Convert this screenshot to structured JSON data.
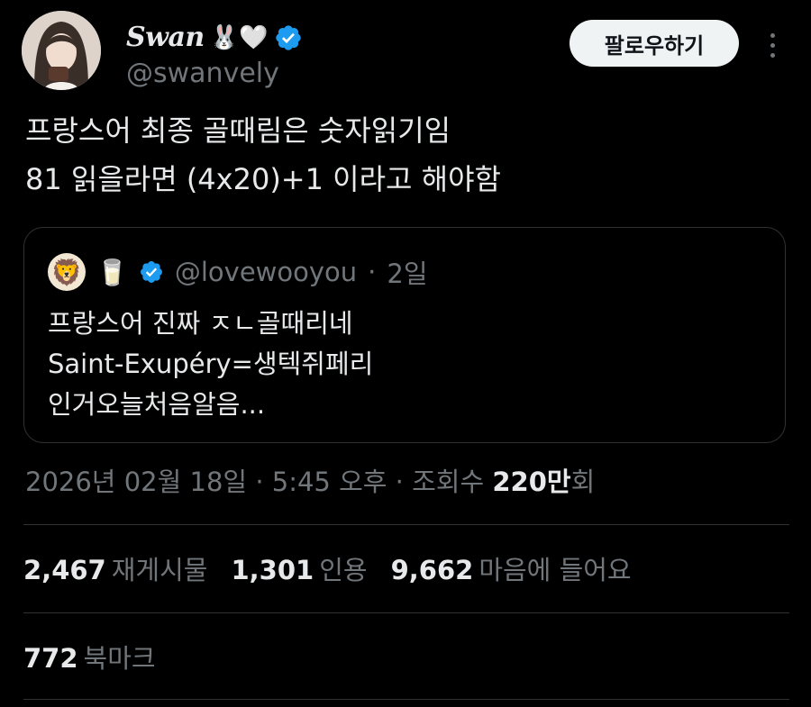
{
  "author": {
    "display_name": "Swan",
    "name_emojis": "🐰🤍",
    "handle": "@swanvely",
    "verified_color": "#1d9bf0"
  },
  "actions": {
    "follow_label": "팔로우하기",
    "more_icon": "more-vertical-icon"
  },
  "tweet": {
    "text": "프랑스어 최종 골때림은 숫자읽기임\n81 읽을라면 (4x20)+1 이라고 해야함"
  },
  "quote": {
    "avatar_emoji": "🦁",
    "name_emoji": "🥛",
    "handle": "@lovewooyou",
    "sep": "·",
    "time": "2일",
    "text": "프랑스어 진짜 ㅈㄴ골때리네\nSaint-Exupéry=생텍쥐페리\n인거오늘처음알음..."
  },
  "meta": {
    "date": "2026년 02월 18일",
    "sep1": "·",
    "time": "5:45 오후",
    "sep2": "·",
    "views_label": "조회수",
    "views_value": "220만",
    "views_suffix": "회"
  },
  "stats": {
    "retweets_value": "2,467",
    "retweets_label": "재게시물",
    "quotes_value": "1,301",
    "quotes_label": "인용",
    "likes_value": "9,662",
    "likes_label": "마음에 들어요",
    "bookmarks_value": "772",
    "bookmarks_label": "북마크"
  }
}
